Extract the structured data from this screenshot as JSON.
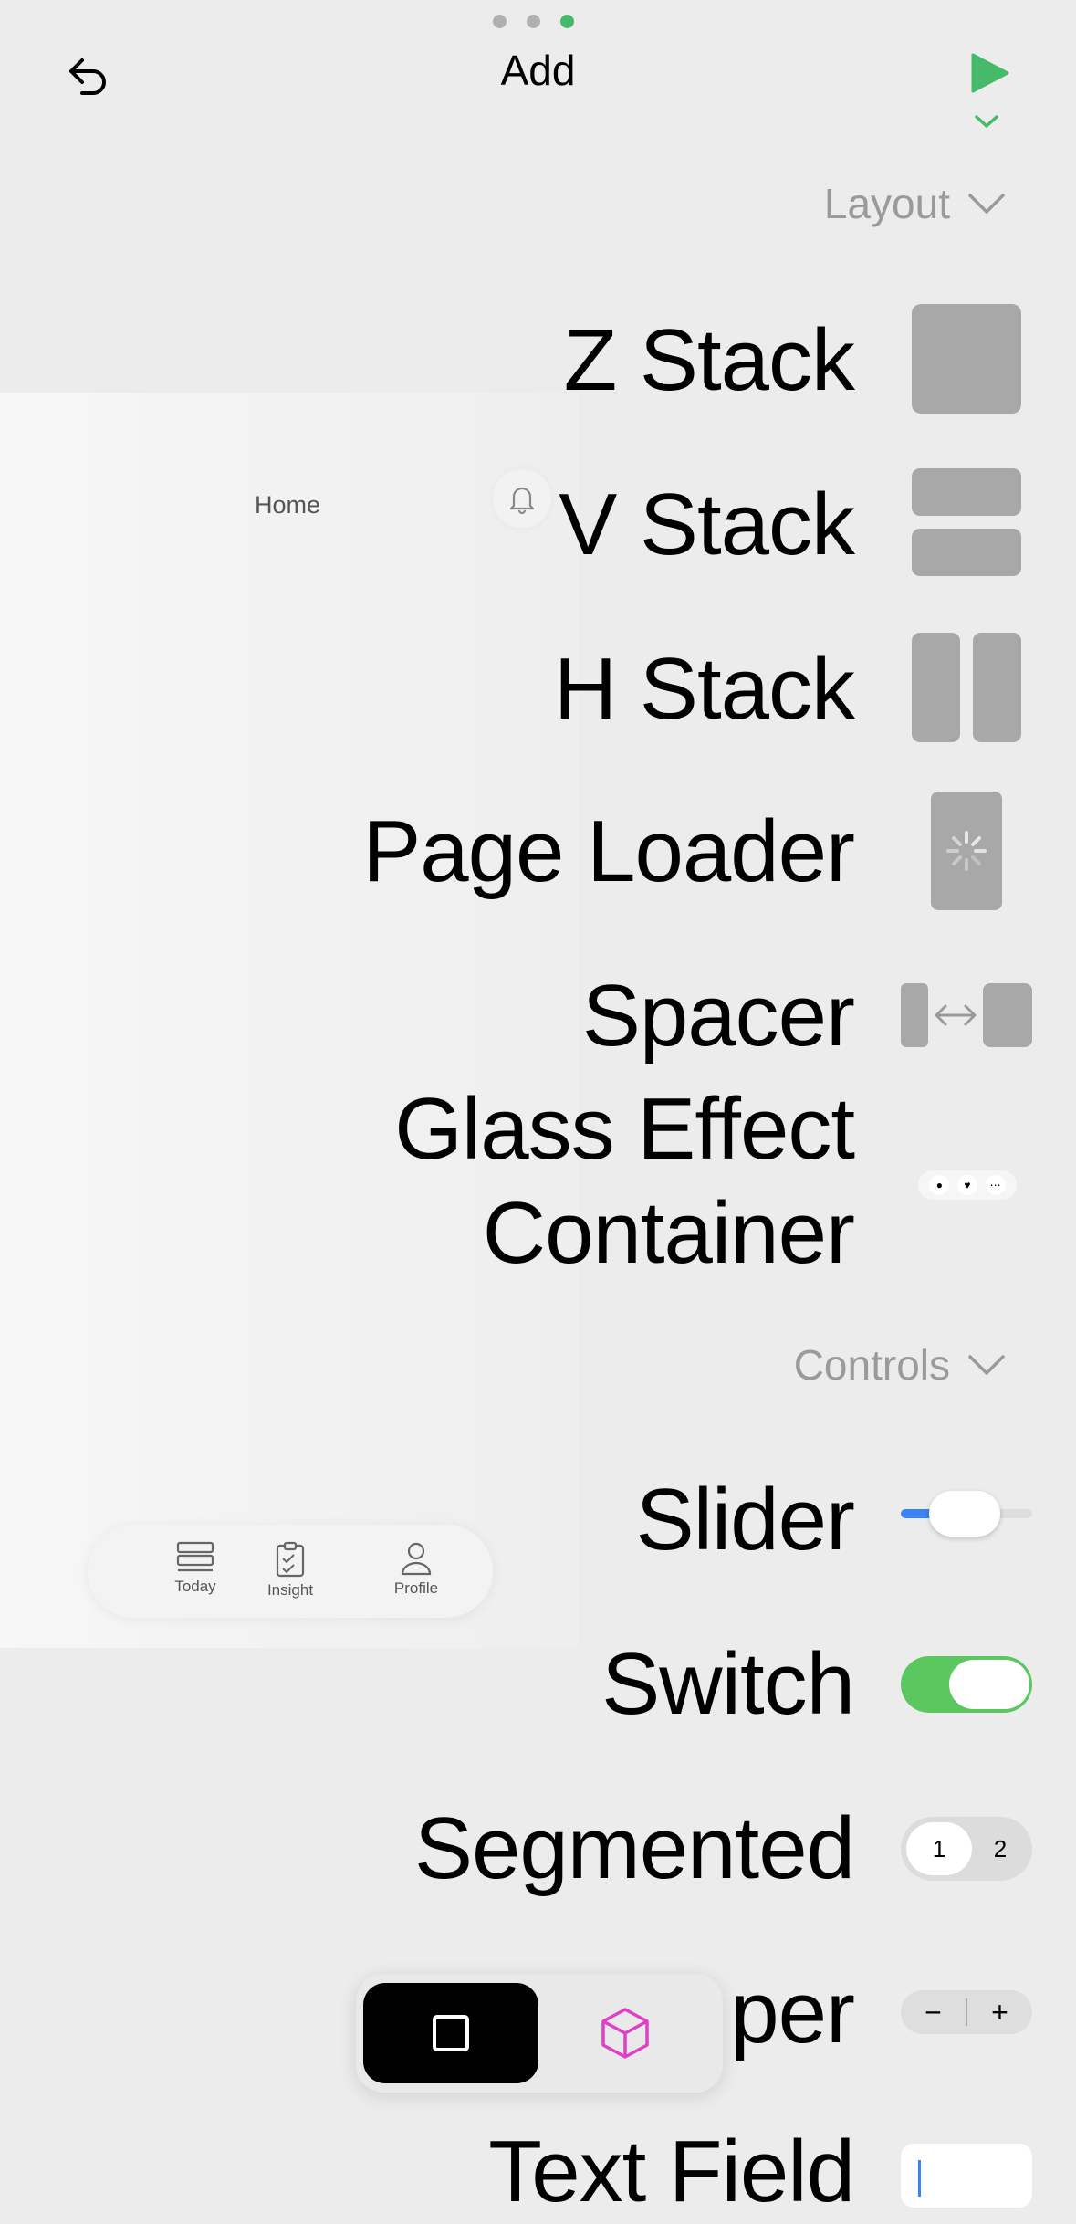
{
  "header": {
    "title": "Add",
    "page_dots": 3,
    "active_dot_index": 2
  },
  "preview": {
    "title": "Home",
    "tabs": [
      {
        "label": "Today"
      },
      {
        "label": "Insight"
      },
      {
        "label": "Profile"
      }
    ]
  },
  "sections": {
    "layout": "Layout",
    "controls": "Controls"
  },
  "components": {
    "z_stack": "Z Stack",
    "v_stack": "V Stack",
    "h_stack": "H Stack",
    "page_loader": "Page Loader",
    "spacer": "Spacer",
    "glass_line1": "Glass Effect",
    "glass_line2": "Container",
    "slider": "Slider",
    "switch": "Switch",
    "segmented": "Segmented",
    "stepper": "per",
    "text_field": "Text Field"
  },
  "previews": {
    "segmented_options": [
      "1",
      "2"
    ],
    "stepper_minus": "−",
    "stepper_plus": "+",
    "glass_icons": [
      "bag-icon",
      "heart-icon",
      "more-icon"
    ],
    "slider_value": 0.45,
    "switch_on": true
  },
  "colors": {
    "accent_green": "#46b96a",
    "switch_green": "#5ac85f",
    "slider_blue": "#3b82f6",
    "cube_magenta": "#e040c8"
  }
}
